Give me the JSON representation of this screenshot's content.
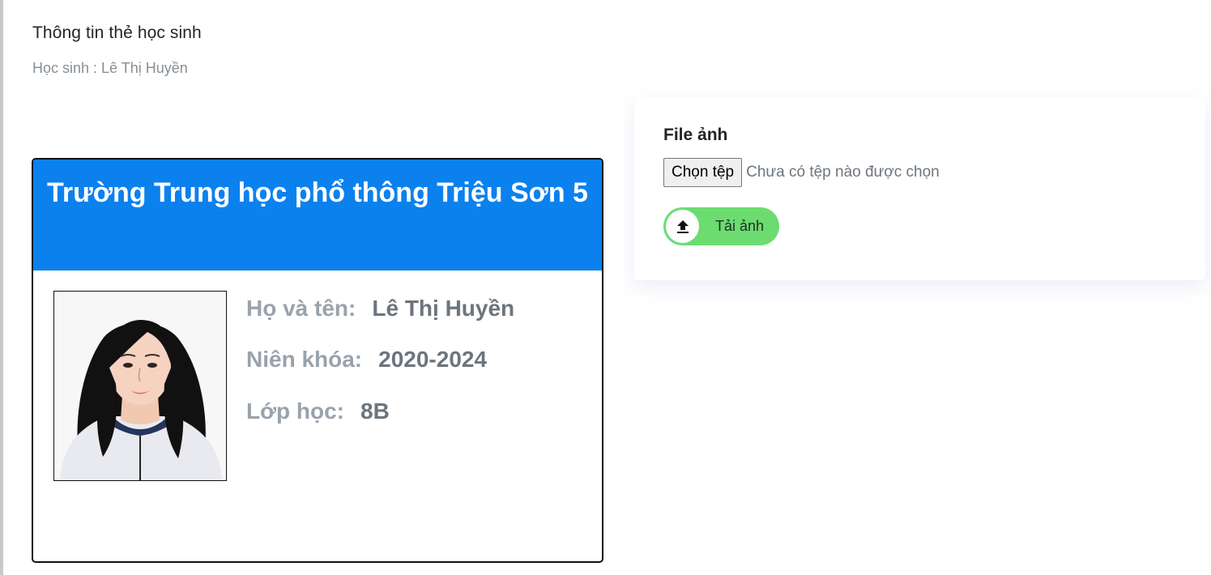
{
  "page": {
    "title": "Thông tin thẻ học sinh",
    "subtitle": "Học sinh : Lê Thị Huyền"
  },
  "card": {
    "school_name": "Trường Trung học phổ thông Triệu Sơn 5",
    "fields": [
      {
        "label": "Họ và tên:",
        "value": "Lê Thị Huyền"
      },
      {
        "label": "Niên khóa:",
        "value": "2020-2024"
      },
      {
        "label": "Lớp học:",
        "value": "8B"
      }
    ],
    "header_color": "#0b81ee"
  },
  "upload": {
    "title": "File ảnh",
    "choose_file_label": "Chọn tệp",
    "file_status": "Chưa có tệp nào được chọn",
    "upload_button_label": "Tải ảnh",
    "upload_icon": "upload-icon",
    "button_color": "#6cdc71"
  }
}
